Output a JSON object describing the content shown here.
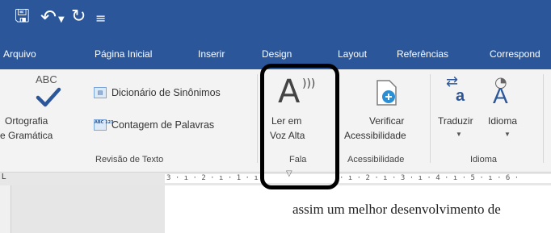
{
  "quick_access": {
    "save_icon": "save-icon",
    "undo_icon": "undo-icon",
    "redo_icon": "redo-icon",
    "customize_icon": "customize-icon"
  },
  "tabs": [
    {
      "label": "Arquivo"
    },
    {
      "label": "Página Inicial"
    },
    {
      "label": "Inserir"
    },
    {
      "label": "Design"
    },
    {
      "label": "Layout"
    },
    {
      "label": "Referências"
    },
    {
      "label": "Correspond"
    }
  ],
  "ribbon": {
    "revisao": {
      "abc_text": "ABC",
      "ortografia_label_1": "Ortografia",
      "ortografia_label_2": "e Gramática",
      "dicionario_label": "Dicionário de Sinônimos",
      "contagem_icon_text": "ABC 123",
      "contagem_label": "Contagem de Palavras",
      "group_label": "Revisão de Texto"
    },
    "fala": {
      "ler_label_1": "Ler em",
      "ler_label_2": "Voz Alta",
      "group_label": "Fala"
    },
    "acessibilidade": {
      "verificar_label_1": "Verificar",
      "verificar_label_2": "Acessibilidade",
      "group_label": "Acessibilidade"
    },
    "idioma": {
      "traduzir_label": "Traduzir",
      "idioma_label": "Idioma",
      "group_label": "Idioma"
    }
  },
  "ruler": {
    "left_marks": "3 · ı · 2 · ı · 1 · ı",
    "right_marks": "· ı · 2 · ı · 3 · ı · 4 · ı · 5 · ı · 6 ·"
  },
  "document": {
    "line1": "assim um melhor desenvolvimento de"
  },
  "colors": {
    "accent": "#2b579a",
    "highlight": "#000000"
  }
}
